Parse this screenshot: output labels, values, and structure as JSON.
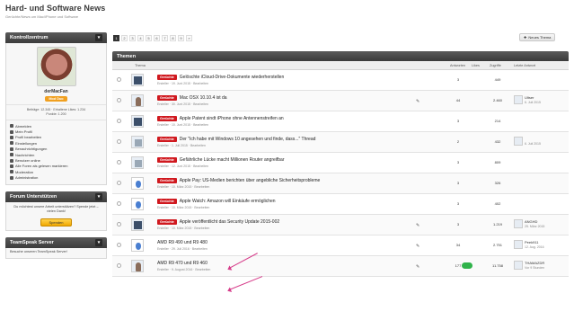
{
  "site": {
    "title": "Hard- und Software News",
    "subtitle": "Gerüchte/News um Mac/iPhone und Software"
  },
  "sidebar": {
    "control_center": "Kontrollzentrum",
    "username": "derMacFan",
    "user_badge": "Mod Duo",
    "stats_line1": "Beiträge: 12.345 · Erhaltene Likes: 1.234",
    "stats_line2": "Punkte: 1.200",
    "menu": [
      "Abmelden",
      "Mein Profil",
      "Profil bearbeiten",
      "Einstellungen",
      "Benachrichtigungen",
      "Nachrichten",
      "Benutzer online",
      "Alle Foren als gelesen markieren",
      "Moderation",
      "Administration"
    ],
    "support_title": "Forum Unterstützen",
    "support_text": "Du möchtest unsere Arbeit unterstützen? Spende jetzt – vielen Dank!",
    "donate_label": "Spenden",
    "teamspeak_title": "TeamSpeak Server",
    "teamspeak_text": "Besuche unseren TeamSpeak Server!"
  },
  "pagination": {
    "pages": [
      "1",
      "2",
      "3",
      "4",
      "5",
      "6",
      "7",
      "8",
      "9",
      "»"
    ],
    "new_topic": "Neues Thema"
  },
  "threads": {
    "header": "Themen",
    "columns": {
      "topic": "Thema",
      "replies": "Antworten",
      "likes": "Likes",
      "views": "Zugriffe",
      "last_reply": "Letzte Antwort"
    },
    "prefix": "Gerüchte",
    "rows": [
      {
        "title": "Gelöschte iCloud-Drive-Dokumente wiederherstellen",
        "meta": "Ersteller · 19. Juni 2015 · Bearbeiten",
        "replies": "3",
        "likes": "",
        "views": "449",
        "last_user": "",
        "last_date": "",
        "prefixed": true,
        "thumb": "dark"
      },
      {
        "title": "Mac OSX 10.10.4 ist da",
        "meta": "Ersteller · 30. Juni 2015 · Bearbeiten",
        "replies": "44",
        "likes": "",
        "views": "2.460",
        "last_user": "Ultser",
        "last_date": "6. Juli 2015",
        "prefixed": true,
        "thumb": "person"
      },
      {
        "title": "Apple Patent sindt iPhone ohne Antennenstreifen an",
        "meta": "Ersteller · 10. Juni 2015 · Bearbeiten",
        "replies": "3",
        "likes": "",
        "views": "214",
        "last_user": "",
        "last_date": "",
        "prefixed": true,
        "thumb": "dark"
      },
      {
        "title": "Der \"Ich habe mit Windows 10 angesehen und finde, dass...\" Thread",
        "meta": "Ersteller · 1. Juli 2015 · Bearbeiten",
        "replies": "2",
        "likes": "",
        "views": "432",
        "last_user": "",
        "last_date": "6. Juli 2015",
        "prefixed": true,
        "thumb": "warn"
      },
      {
        "title": "Gefährliche Lücke macht Millionen Router angreifbar",
        "meta": "Ersteller · 12. Juni 2015 · Bearbeiten",
        "replies": "3",
        "likes": "",
        "views": "809",
        "last_user": "",
        "last_date": "",
        "prefixed": true,
        "thumb": "warn"
      },
      {
        "title": "Apple Pay: US-Medien berichten über angebliche Sicherheitsprobleme",
        "meta": "Ersteller · 10. März 2015 · Bearbeiten",
        "replies": "3",
        "likes": "",
        "views": "326",
        "last_user": "",
        "last_date": "",
        "prefixed": true,
        "thumb": "apple"
      },
      {
        "title": "Apple Watch: Amazon will Einkäufe ermöglichen",
        "meta": "Ersteller · 10. März 2015 · Bearbeiten",
        "replies": "3",
        "likes": "",
        "views": "402",
        "last_user": "",
        "last_date": "",
        "prefixed": true,
        "thumb": "apple"
      },
      {
        "title": "Apple veröffentlicht das Security Update 2015-002",
        "meta": "Ersteller · 10. März 2015 · Bearbeiten",
        "replies": "3",
        "likes": "",
        "views": "1.219",
        "last_user": "ANGHD",
        "last_date": "25. März 2015",
        "prefixed": true,
        "thumb": "dark"
      },
      {
        "title": "AMD R9 490 und R9 480",
        "meta": "Ersteller · 29. Juli 2016 · Bearbeiten",
        "replies": "34",
        "likes": "",
        "views": "2.751",
        "last_user": "Peek911",
        "last_date": "12. Aug. 2016",
        "prefixed": false,
        "thumb": "apple"
      },
      {
        "title": "AMD R9 470 und R9 460",
        "meta": "Ersteller · 9. August 2016 · Bearbeiten",
        "replies": "177",
        "likes": "",
        "views": "11.758",
        "last_user": "THAMAZDR",
        "last_date": "Vor 9 Stunden",
        "prefixed": false,
        "thumb": "person"
      }
    ]
  }
}
